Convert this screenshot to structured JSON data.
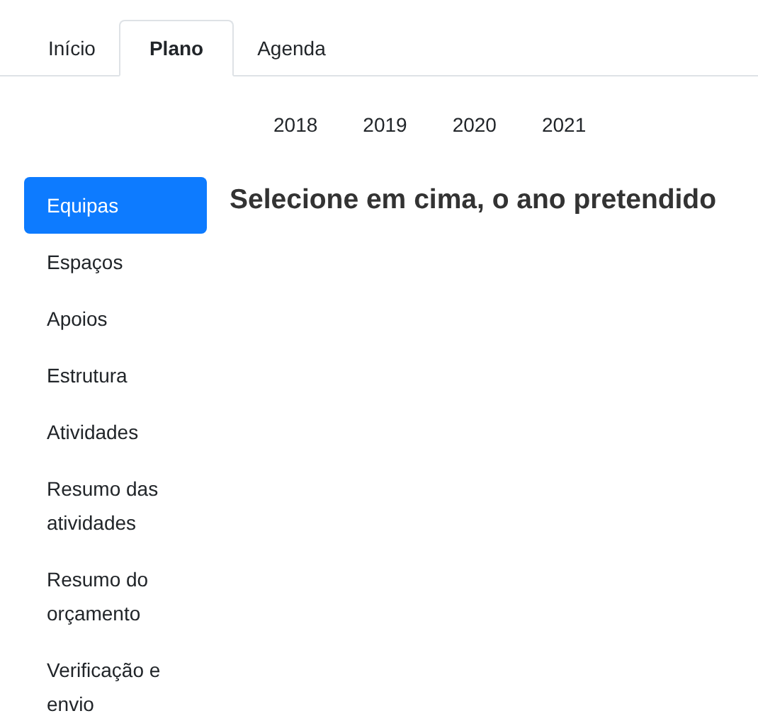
{
  "tabs": [
    {
      "label": "Início",
      "selected": false
    },
    {
      "label": "Plano",
      "selected": true
    },
    {
      "label": "Agenda",
      "selected": false
    }
  ],
  "years": [
    {
      "label": "2018",
      "selected": false
    },
    {
      "label": "2019",
      "selected": false
    },
    {
      "label": "2020",
      "selected": false
    },
    {
      "label": "2021",
      "selected": false
    }
  ],
  "sidebar": {
    "items": [
      {
        "label": "Equipas",
        "selected": true
      },
      {
        "label": "Espaços",
        "selected": false
      },
      {
        "label": "Apoios",
        "selected": false
      },
      {
        "label": "Estrutura",
        "selected": false
      },
      {
        "label": "Atividades",
        "selected": false
      },
      {
        "label": "Resumo das atividades",
        "selected": false
      },
      {
        "label": "Resumo do orçamento",
        "selected": false
      },
      {
        "label": "Verificação e envio",
        "selected": false
      }
    ]
  },
  "heading": "Selecione em cima, o ano pretendido"
}
